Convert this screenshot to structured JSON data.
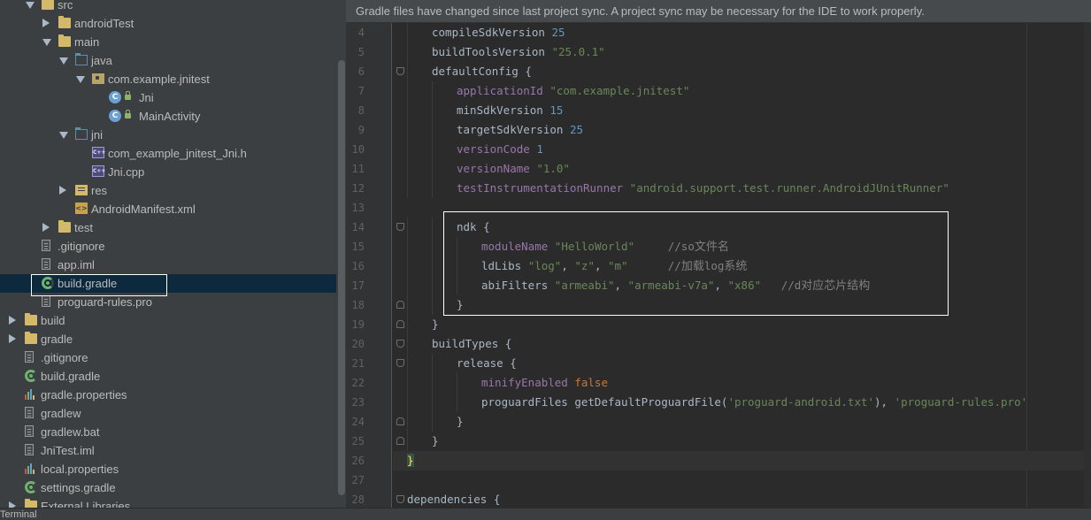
{
  "project_tree": {
    "items": [
      {
        "label": "src",
        "icon": "folder-icon",
        "toggle": "open"
      },
      {
        "label": "androidTest",
        "icon": "folder-icon",
        "toggle": "closed"
      },
      {
        "label": "main",
        "icon": "folder-icon",
        "toggle": "open"
      },
      {
        "label": "java",
        "icon": "source-folder-icon",
        "toggle": "open"
      },
      {
        "label": "com.example.jnitest",
        "icon": "package-icon",
        "toggle": "open"
      },
      {
        "label": "Jni",
        "icon": "class-icon",
        "badge": "C",
        "toggle": "none"
      },
      {
        "label": "MainActivity",
        "icon": "class-icon",
        "badge": "C",
        "toggle": "none"
      },
      {
        "label": "jni",
        "icon": "source-folder-icon",
        "toggle": "open"
      },
      {
        "label": "com_example_jnitest_Jni.h",
        "icon": "cpp-file-icon",
        "toggle": "none"
      },
      {
        "label": "Jni.cpp",
        "icon": "cpp-file-icon",
        "toggle": "none"
      },
      {
        "label": "res",
        "icon": "res-folder-icon",
        "toggle": "closed"
      },
      {
        "label": "AndroidManifest.xml",
        "icon": "xml-file-icon",
        "toggle": "none"
      },
      {
        "label": "test",
        "icon": "folder-icon",
        "toggle": "closed"
      },
      {
        "label": ".gitignore",
        "icon": "text-file-icon",
        "toggle": "none"
      },
      {
        "label": "app.iml",
        "icon": "text-file-icon",
        "toggle": "none"
      },
      {
        "label": "build.gradle",
        "icon": "gradle-icon",
        "toggle": "none",
        "selected": true
      },
      {
        "label": "proguard-rules.pro",
        "icon": "text-file-icon",
        "toggle": "none"
      },
      {
        "label": "build",
        "icon": "folder-icon",
        "toggle": "closed"
      },
      {
        "label": "gradle",
        "icon": "folder-icon",
        "toggle": "closed"
      },
      {
        "label": ".gitignore",
        "icon": "text-file-icon",
        "toggle": "none"
      },
      {
        "label": "build.gradle",
        "icon": "gradle-icon",
        "toggle": "none"
      },
      {
        "label": "gradle.properties",
        "icon": "properties-file-icon",
        "toggle": "none"
      },
      {
        "label": "gradlew",
        "icon": "text-file-icon",
        "toggle": "none"
      },
      {
        "label": "gradlew.bat",
        "icon": "text-file-icon",
        "toggle": "none"
      },
      {
        "label": "JniTest.iml",
        "icon": "text-file-icon",
        "toggle": "none"
      },
      {
        "label": "local.properties",
        "icon": "properties-file-icon",
        "toggle": "none"
      },
      {
        "label": "settings.gradle",
        "icon": "gradle-icon",
        "toggle": "none"
      },
      {
        "label": "External Libraries",
        "icon": "library-icon",
        "toggle": "closed"
      }
    ]
  },
  "editor": {
    "banner": "Gradle files have changed since last project sync. A project sync may be necessary for the IDE to work properly.",
    "lines": [
      {
        "num": "4",
        "tokens": [
          {
            "t": "compileSdkVersion ",
            "c": "ident"
          },
          {
            "t": "25",
            "c": "num"
          }
        ]
      },
      {
        "num": "5",
        "tokens": [
          {
            "t": "buildToolsVersion ",
            "c": "ident"
          },
          {
            "t": "\"25.0.1\"",
            "c": "str"
          }
        ]
      },
      {
        "num": "6",
        "fold": "start",
        "tokens": [
          {
            "t": "defaultConfig {",
            "c": "ident"
          }
        ]
      },
      {
        "num": "7",
        "tokens": [
          {
            "t": "applicationId ",
            "c": "prop"
          },
          {
            "t": "\"com.example.jnitest\"",
            "c": "str"
          }
        ]
      },
      {
        "num": "8",
        "tokens": [
          {
            "t": "minSdkVersion ",
            "c": "ident"
          },
          {
            "t": "15",
            "c": "num"
          }
        ]
      },
      {
        "num": "9",
        "tokens": [
          {
            "t": "targetSdkVersion ",
            "c": "ident"
          },
          {
            "t": "25",
            "c": "num"
          }
        ]
      },
      {
        "num": "10",
        "tokens": [
          {
            "t": "versionCode ",
            "c": "prop"
          },
          {
            "t": "1",
            "c": "num"
          }
        ]
      },
      {
        "num": "11",
        "tokens": [
          {
            "t": "versionName ",
            "c": "prop"
          },
          {
            "t": "\"1.0\"",
            "c": "str"
          }
        ]
      },
      {
        "num": "12",
        "tokens": [
          {
            "t": "testInstrumentationRunner ",
            "c": "prop"
          },
          {
            "t": "\"android.support.test.runner.AndroidJUnitRunner\"",
            "c": "str"
          }
        ]
      },
      {
        "num": "13",
        "tokens": []
      },
      {
        "num": "14",
        "fold": "start",
        "tokens": [
          {
            "t": "ndk {",
            "c": "ident"
          }
        ]
      },
      {
        "num": "15",
        "tokens": [
          {
            "t": "moduleName ",
            "c": "prop"
          },
          {
            "t": "\"HelloWorld\"",
            "c": "str"
          },
          {
            "t": "     //so",
            "c": "comment"
          },
          {
            "t": "文件名",
            "c": "comment-cjk"
          }
        ]
      },
      {
        "num": "16",
        "tokens": [
          {
            "t": "ldLibs ",
            "c": "ident"
          },
          {
            "t": "\"log\"",
            "c": "str"
          },
          {
            "t": ", ",
            "c": "ident"
          },
          {
            "t": "\"z\"",
            "c": "str"
          },
          {
            "t": ", ",
            "c": "ident"
          },
          {
            "t": "\"m\"",
            "c": "str"
          },
          {
            "t": "      //",
            "c": "comment"
          },
          {
            "t": "加载",
            "c": "comment-cjk"
          },
          {
            "t": "log",
            "c": "comment"
          },
          {
            "t": "系统",
            "c": "comment-cjk"
          }
        ]
      },
      {
        "num": "17",
        "tokens": [
          {
            "t": "abiFilters ",
            "c": "ident"
          },
          {
            "t": "\"armeabi\"",
            "c": "str"
          },
          {
            "t": ", ",
            "c": "ident"
          },
          {
            "t": "\"armeabi-v7a\"",
            "c": "str"
          },
          {
            "t": ", ",
            "c": "ident"
          },
          {
            "t": "\"x86\"",
            "c": "str"
          },
          {
            "t": "   //d",
            "c": "comment"
          },
          {
            "t": "对应芯片结构",
            "c": "comment-cjk"
          }
        ]
      },
      {
        "num": "18",
        "fold": "end",
        "tokens": [
          {
            "t": "}",
            "c": "ident"
          }
        ]
      },
      {
        "num": "19",
        "fold": "end",
        "tokens": [
          {
            "t": "}",
            "c": "ident"
          }
        ]
      },
      {
        "num": "20",
        "fold": "start",
        "tokens": [
          {
            "t": "buildTypes {",
            "c": "ident"
          }
        ]
      },
      {
        "num": "21",
        "fold": "start",
        "tokens": [
          {
            "t": "release {",
            "c": "ident"
          }
        ]
      },
      {
        "num": "22",
        "tokens": [
          {
            "t": "minifyEnabled ",
            "c": "prop"
          },
          {
            "t": "false",
            "c": "kw"
          }
        ]
      },
      {
        "num": "23",
        "tokens": [
          {
            "t": "proguardFiles getDefaultProguardFile(",
            "c": "ident"
          },
          {
            "t": "'proguard-android.txt'",
            "c": "str"
          },
          {
            "t": "), ",
            "c": "ident"
          },
          {
            "t": "'proguard-rules.pro'",
            "c": "str"
          }
        ]
      },
      {
        "num": "24",
        "fold": "end",
        "tokens": [
          {
            "t": "}",
            "c": "ident"
          }
        ]
      },
      {
        "num": "25",
        "fold": "end",
        "tokens": [
          {
            "t": "}",
            "c": "ident"
          }
        ]
      },
      {
        "num": "26",
        "fold": "end",
        "current": true,
        "tokens": [
          {
            "t": "}",
            "c": "brace-hl"
          }
        ]
      },
      {
        "num": "27",
        "tokens": []
      },
      {
        "num": "28",
        "fold": "start",
        "tokens": [
          {
            "t": "dependencies {",
            "c": "ident"
          }
        ]
      }
    ]
  },
  "bottom_bar": {
    "tool_window": "Terminal"
  },
  "colors": {
    "tree_bg": "#3c3f41",
    "editor_bg": "#2b2b2b",
    "selection": "#0d293e",
    "keyword": "#cc7832",
    "string": "#6a8759",
    "number": "#6897bb",
    "property": "#9876aa",
    "comment": "#808080"
  }
}
